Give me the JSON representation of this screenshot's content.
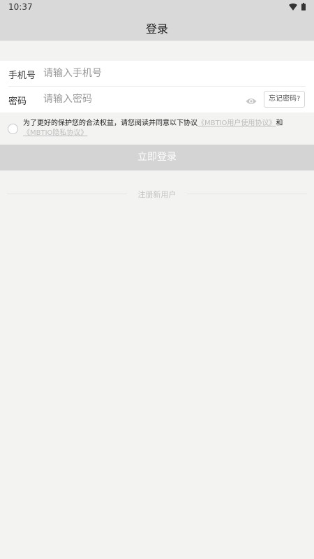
{
  "status_bar": {
    "time": "10:37",
    "icons": [
      "wifi-icon",
      "battery-icon"
    ]
  },
  "header": {
    "title": "登录"
  },
  "form": {
    "phone": {
      "label": "手机号",
      "placeholder": "请输入手机号",
      "value": ""
    },
    "password": {
      "label": "密码",
      "placeholder": "请输入密码",
      "value": "",
      "toggle_icon": "eye-icon",
      "forgot_label": "忘记密码?"
    }
  },
  "agreement": {
    "checked": false,
    "prefix": "为了更好的保护您的合法权益，请您阅读并同意以下协议",
    "user_agreement": "《MBTIO用户使用协议》",
    "conjunction": "和",
    "privacy_agreement": "《MBTIO隐私协议》"
  },
  "login_button": {
    "label": "立即登录"
  },
  "register": {
    "label": "注册新用户"
  },
  "colors": {
    "header_bg": "#d9d9d9",
    "page_bg": "#f3f3f1",
    "button_bg": "#d4d4d4",
    "link_text": "#bdbdbd"
  }
}
